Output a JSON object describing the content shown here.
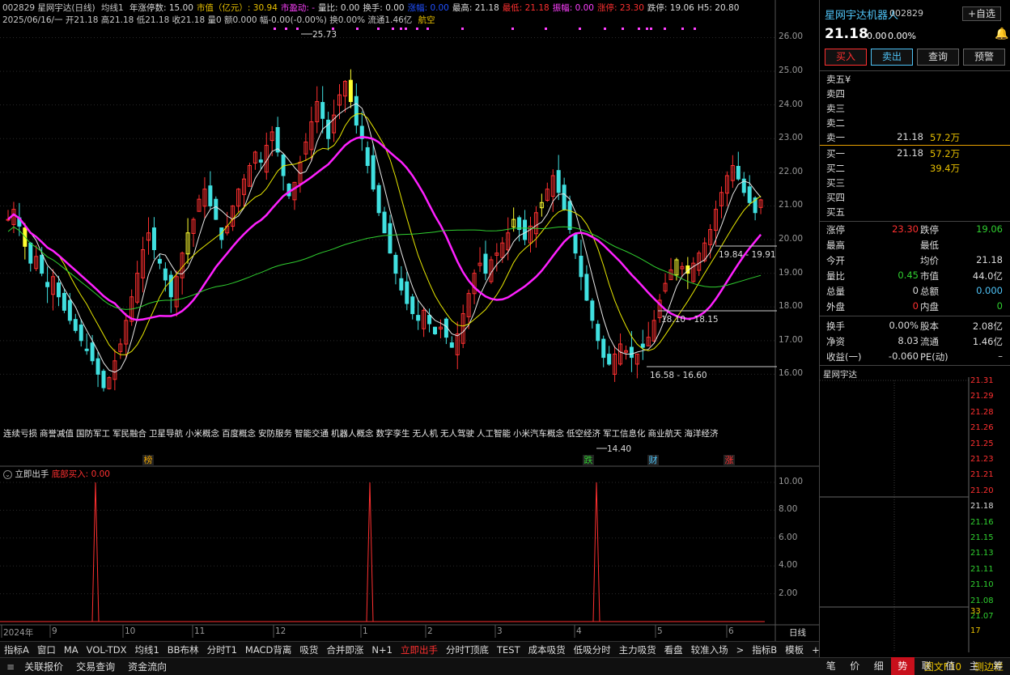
{
  "header": {
    "code_name": "002829 星网宇达(日线)",
    "ma_label": "均线1",
    "ma_items": [
      {
        "text": "年涨停数: 15.00",
        "color": "#dcdcdc"
      },
      {
        "text": "市值（亿元）: 30.94",
        "color": "#e8c000"
      },
      {
        "text": "市盈动: -",
        "color": "#ff40ff"
      },
      {
        "text": "量比: 0.00",
        "color": "#dcdcdc"
      },
      {
        "text": "换手: 0.00",
        "color": "#dcdcdc"
      },
      {
        "text": "涨幅: 0.00",
        "color": "#2050ff"
      },
      {
        "text": "最高: 21.18",
        "color": "#dcdcdc"
      },
      {
        "text": "最低: 21.18",
        "color": "#ff3030"
      },
      {
        "text": "振幅: 0.00",
        "color": "#ff40ff"
      },
      {
        "text": "涨停: 23.30",
        "color": "#ff3030"
      },
      {
        "text": "跌停: 19.06",
        "color": "#dcdcdc"
      },
      {
        "text": "H5: 20.80",
        "color": "#dcdcdc"
      }
    ],
    "line2": "2025/06/16/一 开21.18 高21.18 低21.18 收21.18 量0 额0.000 幅-0.00(-0.00%) 换0.00% 流通1.46亿",
    "tag": "航空"
  },
  "price_axis": [
    "26.00",
    "25.00",
    "24.00",
    "23.00",
    "22.00",
    "21.00",
    "20.00",
    "19.00",
    "18.00",
    "17.00",
    "16.00"
  ],
  "annotations": {
    "high": "25.73",
    "low": "14.40",
    "range1": "19.84 - 19.91",
    "range2": "18.10 - 18.15",
    "range3": "16.58 - 16.60"
  },
  "concepts": [
    "连续亏损",
    "商誉减值",
    "国防军工",
    "军民融合",
    "卫星导航",
    "小米概念",
    "百度概念",
    "安防服务",
    "智能交通",
    "机器人概念",
    "数字孪生",
    "无人机",
    "无人驾驶",
    "人工智能",
    "小米汽车概念",
    "低空经济",
    "军工信息化",
    "商业航天",
    "海洋经济"
  ],
  "badges": [
    {
      "text": "榜",
      "color": "#e8a000"
    },
    {
      "text": "跌",
      "color": "#30d030"
    },
    {
      "text": "财",
      "color": "#4fc3f7"
    },
    {
      "text": "涨",
      "color": "#ff3030"
    }
  ],
  "sub_indicator": {
    "name": "立即出手",
    "value": "底部买入: 0.00",
    "axis": [
      "10.00",
      "8.00",
      "6.00",
      "4.00",
      "2.00"
    ],
    "spikes": [
      0.42,
      1.19,
      2.11
    ],
    "spike_value": 10
  },
  "x_axis": {
    "labels": [
      "2024年",
      "9",
      "10",
      "11",
      "12",
      "1",
      "2",
      "3",
      "4",
      "5",
      "6"
    ],
    "period": "日线"
  },
  "chart_data": {
    "type": "candlestick",
    "x_period": "2024年8月 - 2025年6月",
    "ylim": [
      15.0,
      26.3
    ],
    "closes": [
      20.6,
      20.9,
      20.4,
      19.8,
      19.3,
      19.5,
      19.0,
      18.6,
      18.9,
      18.3,
      17.9,
      17.6,
      17.3,
      17.0,
      16.7,
      16.4,
      16.0,
      15.6,
      15.9,
      16.4,
      16.9,
      17.6,
      18.3,
      19.0,
      19.7,
      20.2,
      19.7,
      19.3,
      18.8,
      18.3,
      18.9,
      19.6,
      20.2,
      20.6,
      21.2,
      21.5,
      21.0,
      20.6,
      20.0,
      20.4,
      21.0,
      21.5,
      21.8,
      22.2,
      22.6,
      22.3,
      22.8,
      23.2,
      22.6,
      21.9,
      21.3,
      21.7,
      22.3,
      22.9,
      23.5,
      24.1,
      23.6,
      23.0,
      23.7,
      24.3,
      24.7,
      24.1,
      23.4,
      23.0,
      22.2,
      21.5,
      20.8,
      20.2,
      19.6,
      19.0,
      18.5,
      18.1,
      17.8,
      17.6,
      17.9,
      17.5,
      17.2,
      17.4,
      17.1,
      16.8,
      17.2,
      17.8,
      18.4,
      19.0,
      19.3,
      19.0,
      19.4,
      19.6,
      19.9,
      20.2,
      20.6,
      20.3,
      20.0,
      20.4,
      20.8,
      21.1,
      21.5,
      21.9,
      21.4,
      20.9,
      20.3,
      19.6,
      18.9,
      18.2,
      17.6,
      17.0,
      16.5,
      16.3,
      16.6,
      16.9,
      16.7,
      16.5,
      16.6,
      16.8,
      17.1,
      17.6,
      18.2,
      18.7,
      19.1,
      19.4,
      19.2,
      19.0,
      19.3,
      19.6,
      19.9,
      20.3,
      20.9,
      21.4,
      21.9,
      22.2,
      21.8,
      21.4,
      21.1,
      20.8,
      21.18
    ],
    "ma_lines": [
      {
        "color": "#e8e8e8"
      },
      {
        "color": "#e8e800"
      },
      {
        "color": "#ff20ff"
      },
      {
        "color": "#30d030"
      }
    ],
    "volume_markers_color": "#ff40ff"
  },
  "bottom_tabs": [
    "指标A",
    "窗口",
    "MA",
    "VOL-TDX",
    "均线1",
    "BB布林",
    "分时T1",
    "MACD背离",
    "吸货",
    "合并即涨",
    "N+1",
    "立即出手",
    "分时T顶底",
    "TEST",
    "成本吸货",
    "低吸分时",
    "主力吸货",
    "看盘",
    "较准入场",
    ">",
    "指标B",
    "模板",
    "+",
    "−"
  ],
  "active_tab": "立即出手",
  "status_bar": {
    "left": [
      "关联报价",
      "交易查询",
      "资金流向"
    ],
    "right": [
      "图文F10",
      "侧边栏"
    ]
  },
  "right_panel": {
    "title": "星网宇达",
    "title_tag": "机器人",
    "code": "002829",
    "fav_button": "自选",
    "price": "21.18",
    "change": "0.00",
    "change_pct": "0.00%",
    "buttons": [
      "买入",
      "卖出",
      "查询",
      "预警"
    ],
    "asks": [
      {
        "label": "卖五",
        "price": "",
        "vol": "",
        "extra": "¥"
      },
      {
        "label": "卖四",
        "price": "",
        "vol": ""
      },
      {
        "label": "卖三",
        "price": "",
        "vol": ""
      },
      {
        "label": "卖二",
        "price": "",
        "vol": ""
      },
      {
        "label": "卖一",
        "price": "21.18",
        "vol": "57.2万"
      }
    ],
    "bids": [
      {
        "label": "买一",
        "price": "21.18",
        "vol": "57.2万"
      },
      {
        "label": "买二",
        "price": "",
        "vol": "39.4万"
      },
      {
        "label": "买三",
        "price": "",
        "vol": ""
      },
      {
        "label": "买四",
        "price": "",
        "vol": ""
      },
      {
        "label": "买五",
        "price": "",
        "vol": ""
      }
    ],
    "stats": [
      {
        "k": "涨停",
        "v": "23.30",
        "c": "#ff3030",
        "k2": "跌停",
        "v2": "19.06",
        "c2": "#30d030"
      },
      {
        "k": "最高",
        "v": "",
        "c": "#dcdcdc",
        "k2": "最低",
        "v2": "",
        "c2": "#dcdcdc"
      },
      {
        "k": "今开",
        "v": "",
        "c": "#dcdcdc",
        "k2": "均价",
        "v2": "21.18",
        "c2": "#dcdcdc"
      },
      {
        "k": "量比",
        "v": "0.45",
        "c": "#30d030",
        "k2": "市值",
        "v2": "44.0亿",
        "c2": "#dcdcdc"
      },
      {
        "k": "总量",
        "v": "0",
        "c": "#dcdcdc",
        "k2": "总额",
        "v2": "0.000",
        "c2": "#4fc3f7"
      },
      {
        "k": "外盘",
        "v": "0",
        "c": "#ff3030",
        "k2": "内盘",
        "v2": "0",
        "c2": "#30d030"
      },
      {
        "k": "换手",
        "v": "0.00%",
        "c": "#dcdcdc",
        "k2": "股本",
        "v2": "2.08亿",
        "c2": "#dcdcdc"
      },
      {
        "k": "净资",
        "v": "8.03",
        "c": "#dcdcdc",
        "k2": "流通",
        "v2": "1.46亿",
        "c2": "#dcdcdc"
      },
      {
        "k": "收益(一)",
        "v": "-0.060",
        "c": "#dcdcdc",
        "k2": "PE(动)",
        "v2": "–",
        "c2": "#dcdcdc"
      }
    ],
    "mini_title": "星网宇达",
    "mini_axis": [
      {
        "v": "21.31",
        "c": "#ff3030"
      },
      {
        "v": "21.29",
        "c": "#ff3030"
      },
      {
        "v": "21.28",
        "c": "#ff3030"
      },
      {
        "v": "21.26",
        "c": "#ff3030"
      },
      {
        "v": "21.25",
        "c": "#ff3030"
      },
      {
        "v": "21.23",
        "c": "#ff3030"
      },
      {
        "v": "21.21",
        "c": "#ff3030"
      },
      {
        "v": "21.20",
        "c": "#ff3030"
      },
      {
        "v": "21.18",
        "c": "#dcdcdc"
      },
      {
        "v": "21.16",
        "c": "#30d030"
      },
      {
        "v": "21.15",
        "c": "#30d030"
      },
      {
        "v": "21.13",
        "c": "#30d030"
      },
      {
        "v": "21.11",
        "c": "#30d030"
      },
      {
        "v": "21.10",
        "c": "#30d030"
      },
      {
        "v": "21.08",
        "c": "#30d030"
      },
      {
        "v": "21.07",
        "c": "#30d030"
      },
      {
        "v": "33",
        "c": "#e8c000"
      },
      {
        "v": "17",
        "c": "#e8c000"
      }
    ],
    "side_tabs": [
      "笔",
      "价",
      "细",
      "势",
      "联",
      "值",
      "主",
      "筹"
    ],
    "active_side_tab": "势"
  }
}
